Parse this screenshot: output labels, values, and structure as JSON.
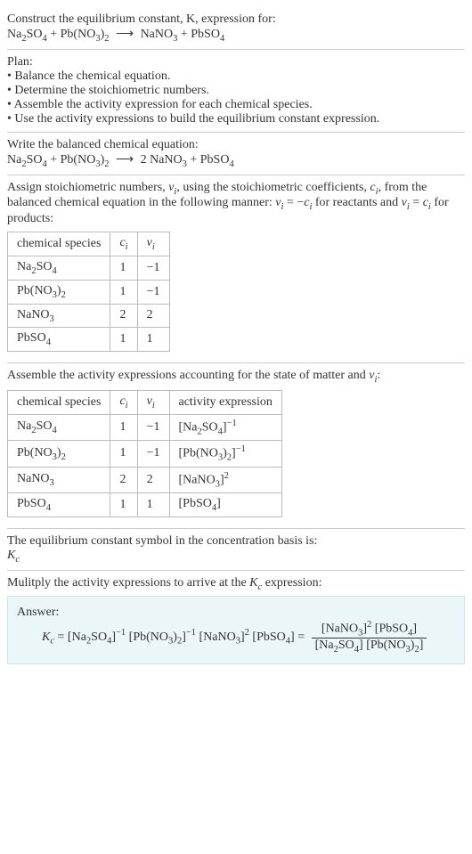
{
  "prompt_line1": "Construct the equilibrium constant, K, expression for:",
  "unbalanced_equation": {
    "r1": "Na",
    "r1s1": "2",
    "r1b": "SO",
    "r1s2": "4",
    "plus1": " + ",
    "r2": "Pb(NO",
    "r2s1": "3",
    "r2b": ")",
    "r2s2": "2",
    "arrow": "⟶",
    "p1": "NaNO",
    "p1s1": "3",
    "plus2": " + ",
    "p2": "PbSO",
    "p2s1": "4"
  },
  "plan_title": "Plan:",
  "plan": [
    "Balance the chemical equation.",
    "Determine the stoichiometric numbers.",
    "Assemble the activity expression for each chemical species.",
    "Use the activity expressions to build the equilibrium constant expression."
  ],
  "balanced_intro": "Write the balanced chemical equation:",
  "balanced_equation": {
    "r1": "Na",
    "r1s1": "2",
    "r1b": "SO",
    "r1s2": "4",
    "plus1": " + ",
    "r2": "Pb(NO",
    "r2s1": "3",
    "r2b": ")",
    "r2s2": "2",
    "arrow": "⟶",
    "p1c": "2 ",
    "p1": "NaNO",
    "p1s1": "3",
    "plus2": " + ",
    "p2": "PbSO",
    "p2s1": "4"
  },
  "stoich_intro_a": "Assign stoichiometric numbers, ",
  "stoich_intro_b": ", using the stoichiometric coefficients, ",
  "stoich_intro_c": ", from the balanced chemical equation in the following manner: ",
  "stoich_intro_d": " for reactants and ",
  "stoich_intro_e": " for products:",
  "nu_i": "ν",
  "nu_i_sub": "i",
  "c_i": "c",
  "c_i_sub": "i",
  "eq_react": " = −",
  "eq_prod": " = ",
  "table1": {
    "h1": "chemical species",
    "h2": "c",
    "h2s": "i",
    "h3": "ν",
    "h3s": "i",
    "rows": [
      {
        "a": "Na",
        "as1": "2",
        "ab": "SO",
        "as2": "4",
        "c": "1",
        "v": "−1"
      },
      {
        "a": "Pb(NO",
        "as1": "3",
        "ab": ")",
        "as2": "2",
        "c": "1",
        "v": "−1"
      },
      {
        "a": "NaNO",
        "as1": "3",
        "ab": "",
        "as2": "",
        "c": "2",
        "v": "2"
      },
      {
        "a": "PbSO",
        "as1": "4",
        "ab": "",
        "as2": "",
        "c": "1",
        "v": "1"
      }
    ]
  },
  "activity_intro_a": "Assemble the activity expressions accounting for the state of matter and ",
  "activity_intro_b": ":",
  "table2": {
    "h1": "chemical species",
    "h2": "c",
    "h2s": "i",
    "h3": "ν",
    "h3s": "i",
    "h4": "activity expression",
    "rows": [
      {
        "a": "Na",
        "as1": "2",
        "ab": "SO",
        "as2": "4",
        "c": "1",
        "v": "−1",
        "ex_l": "[Na",
        "ex_s1": "2",
        "ex_m": "SO",
        "ex_s2": "4",
        "ex_r": "]",
        "ex_p": "−1"
      },
      {
        "a": "Pb(NO",
        "as1": "3",
        "ab": ")",
        "as2": "2",
        "c": "1",
        "v": "−1",
        "ex_l": "[Pb(NO",
        "ex_s1": "3",
        "ex_m": ")",
        "ex_s2": "2",
        "ex_r": "]",
        "ex_p": "−1"
      },
      {
        "a": "NaNO",
        "as1": "3",
        "ab": "",
        "as2": "",
        "c": "2",
        "v": "2",
        "ex_l": "[NaNO",
        "ex_s1": "3",
        "ex_m": "",
        "ex_s2": "",
        "ex_r": "]",
        "ex_p": "2"
      },
      {
        "a": "PbSO",
        "as1": "4",
        "ab": "",
        "as2": "",
        "c": "1",
        "v": "1",
        "ex_l": "[PbSO",
        "ex_s1": "4",
        "ex_m": "",
        "ex_s2": "",
        "ex_r": "]",
        "ex_p": ""
      }
    ]
  },
  "kc_intro": "The equilibrium constant symbol in the concentration basis is:",
  "kc_symbol": "K",
  "kc_sub": "c",
  "multiply_intro_a": "Mulitply the activity expressions to arrive at the ",
  "multiply_intro_b": " expression:",
  "answer_label": "Answer:",
  "answer": {
    "lhs_K": "K",
    "lhs_Ks": "c",
    "eq": " = ",
    "t1_l": "[Na",
    "t1_s1": "2",
    "t1_m": "SO",
    "t1_s2": "4",
    "t1_r": "]",
    "t1_p": "−1",
    "sp": " ",
    "t2_l": "[Pb(NO",
    "t2_s1": "3",
    "t2_m": ")",
    "t2_s2": "2",
    "t2_r": "]",
    "t2_p": "−1",
    "t3_l": "[NaNO",
    "t3_s1": "3",
    "t3_r": "]",
    "t3_p": "2",
    "t4_l": "[PbSO",
    "t4_s1": "4",
    "t4_r": "]",
    "eq2": " = ",
    "num_t1_l": "[NaNO",
    "num_t1_s": "3",
    "num_t1_r": "]",
    "num_t1_p": "2",
    "num_t2_l": "[PbSO",
    "num_t2_s": "4",
    "num_t2_r": "]",
    "den_t1_l": "[Na",
    "den_t1_s1": "2",
    "den_t1_m": "SO",
    "den_t1_s2": "4",
    "den_t1_r": "]",
    "den_t2_l": "[Pb(NO",
    "den_t2_s1": "3",
    "den_t2_m": ")",
    "den_t2_s2": "2",
    "den_t2_r": "]"
  }
}
